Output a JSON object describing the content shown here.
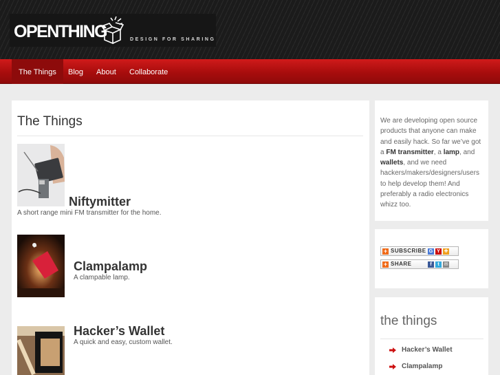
{
  "header": {
    "logo_text": "OPENTHING",
    "tagline": "DESIGN FOR SHARING"
  },
  "nav": {
    "items": [
      {
        "label": "The Things",
        "active": true
      },
      {
        "label": "Blog"
      },
      {
        "label": "About"
      },
      {
        "label": "Collaborate"
      }
    ]
  },
  "main": {
    "title": "The Things",
    "things": [
      {
        "name": "Niftymitter",
        "description": "A short range mini FM transmitter for the home."
      },
      {
        "name": "Clampalamp",
        "description": "A clampable lamp."
      },
      {
        "name": "Hacker’s Wallet",
        "description": "A quick and easy, custom wallet."
      }
    ]
  },
  "sidebar": {
    "about": {
      "t1": "We are developing open source products that anyone can make and easily hack. So far we’ve got a ",
      "b1": "FM transmitter",
      "t2": ", a ",
      "b2": "lamp",
      "t3": ", and ",
      "b3": "wallets",
      "t4": ", and we need hackers/makers/designers/users to help develop them! And preferably a radio electronics whizz too."
    },
    "badges": {
      "subscribe": "SUBSCRIBE",
      "share": "SHARE"
    },
    "things_box": {
      "heading": "the things",
      "links": [
        "Hacker’s Wallet",
        "Clampalamp"
      ]
    }
  },
  "colors": {
    "nav_red": "#b81212",
    "accent_arrow": "#cc1111"
  }
}
